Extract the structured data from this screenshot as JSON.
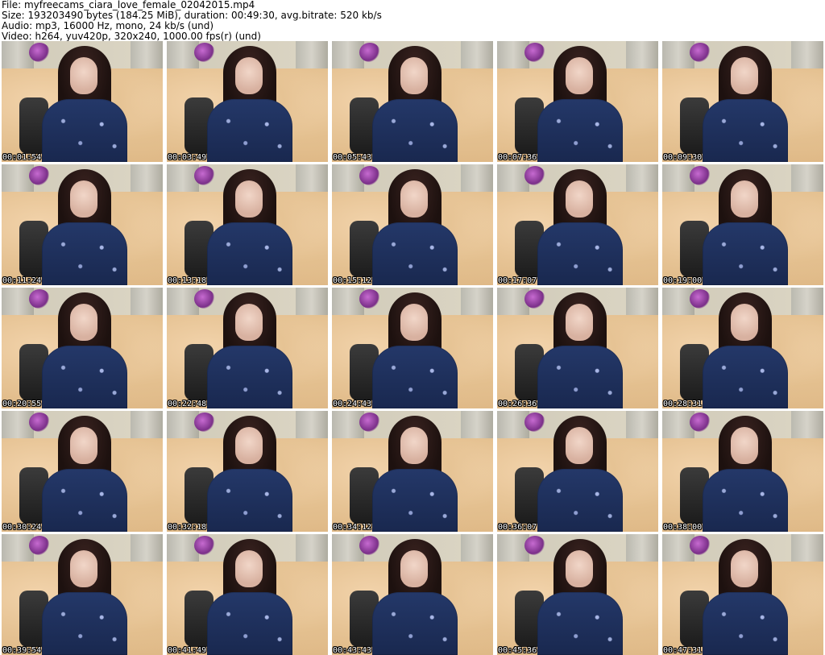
{
  "header": {
    "line1": "File: myfreecams_ciara_love_female_02042015.mp4",
    "line2": "Size: 193203490 bytes (184.25 MiB), duration: 00:49:30, avg.bitrate: 520 kb/s",
    "line3": "Audio: mp3, 16000 Hz, mono, 24 kb/s (und)",
    "line4": "Video: h264, yuv420p, 320x240, 1000.00 fps(r) (und)"
  },
  "thumbnails": [
    {
      "timestamp": "00:01:54"
    },
    {
      "timestamp": "00:03:49"
    },
    {
      "timestamp": "00:05:43"
    },
    {
      "timestamp": "00:07:36"
    },
    {
      "timestamp": "00:09:30"
    },
    {
      "timestamp": "00:11:24"
    },
    {
      "timestamp": "00:13:18"
    },
    {
      "timestamp": "00:15:12"
    },
    {
      "timestamp": "00:17:07"
    },
    {
      "timestamp": "00:19:00"
    },
    {
      "timestamp": "00:20:55"
    },
    {
      "timestamp": "00:22:48"
    },
    {
      "timestamp": "00:24:43"
    },
    {
      "timestamp": "00:26:36"
    },
    {
      "timestamp": "00:28:31"
    },
    {
      "timestamp": "00:30:24"
    },
    {
      "timestamp": "00:32:18"
    },
    {
      "timestamp": "00:34:12"
    },
    {
      "timestamp": "00:36:07"
    },
    {
      "timestamp": "00:38:00"
    },
    {
      "timestamp": "00:39:54"
    },
    {
      "timestamp": "00:41:49"
    },
    {
      "timestamp": "00:43:43"
    },
    {
      "timestamp": "00:45:36"
    },
    {
      "timestamp": "00:47:31"
    }
  ]
}
